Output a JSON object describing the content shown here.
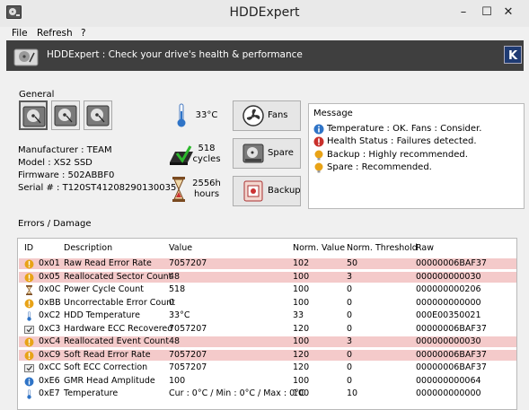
{
  "window": {
    "title": "HDDExpert"
  },
  "menu": [
    "File",
    "Refresh",
    "?"
  ],
  "banner": {
    "text": "HDDExpert : Check your drive's health & performance"
  },
  "general": {
    "label": "General",
    "drives": [
      "drive-1",
      "drive-2",
      "drive-3"
    ],
    "info": {
      "manufacturer": "Manufacturer : TEAM",
      "model": "Model : XS2 SSD",
      "firmware": "Firmware : 502ABBF0",
      "serial": "Serial # : T120ST41208290130035"
    },
    "temperature": "33°C",
    "cycles_value": "518",
    "cycles_unit": "cycles",
    "hours_value": "2556h",
    "hours_unit": "hours"
  },
  "buttons": {
    "fans": "Fans",
    "spare": "Spare",
    "backup": "Backup"
  },
  "message": {
    "title": "Message",
    "items": [
      {
        "icon": "info-icon",
        "text": "Temperature : OK. Fans : Consider."
      },
      {
        "icon": "error-icon",
        "text": "Health Status : Failures detected."
      },
      {
        "icon": "warning-icon",
        "text": "Backup : Highly recommended."
      },
      {
        "icon": "warning-icon",
        "text": "Spare : Recommended."
      }
    ]
  },
  "errors": {
    "label": "Errors / Damage",
    "columns": [
      "ID",
      "Description",
      "Value",
      "Norm. Value",
      "Norm. Threshold",
      "Raw"
    ],
    "rows": [
      {
        "icon": "warning-icon",
        "id": "0x01",
        "desc": "Raw Read Error Rate",
        "value": "7057207",
        "norm": "102",
        "thresh": "50",
        "raw": "00000006BAF37",
        "highlight": true
      },
      {
        "icon": "warning-icon",
        "id": "0x05",
        "desc": "Reallocated Sector Count",
        "value": "48",
        "norm": "100",
        "thresh": "3",
        "raw": "000000000030",
        "highlight": true
      },
      {
        "icon": "hourglass-icon",
        "id": "0x0C",
        "desc": "Power Cycle Count",
        "value": "518",
        "norm": "100",
        "thresh": "0",
        "raw": "000000000206",
        "highlight": false
      },
      {
        "icon": "warning-icon",
        "id": "0xBB",
        "desc": "Uncorrectable Error Count",
        "value": "0",
        "norm": "100",
        "thresh": "0",
        "raw": "000000000000",
        "highlight": false
      },
      {
        "icon": "thermometer-icon",
        "id": "0xC2",
        "desc": "HDD Temperature",
        "value": "33°C",
        "norm": "33",
        "thresh": "0",
        "raw": "000E00350021",
        "highlight": false
      },
      {
        "icon": "ecc-icon",
        "id": "0xC3",
        "desc": "Hardware ECC Recovered",
        "value": "7057207",
        "norm": "120",
        "thresh": "0",
        "raw": "00000006BAF37",
        "highlight": false
      },
      {
        "icon": "warning-icon",
        "id": "0xC4",
        "desc": "Reallocated Event Count",
        "value": "48",
        "norm": "100",
        "thresh": "3",
        "raw": "000000000030",
        "highlight": true
      },
      {
        "icon": "warning-icon",
        "id": "0xC9",
        "desc": "Soft Read Error Rate",
        "value": "7057207",
        "norm": "120",
        "thresh": "0",
        "raw": "00000006BAF37",
        "highlight": true
      },
      {
        "icon": "ecc-icon",
        "id": "0xCC",
        "desc": "Soft ECC Correction",
        "value": "7057207",
        "norm": "120",
        "thresh": "0",
        "raw": "00000006BAF37",
        "highlight": false
      },
      {
        "icon": "info-icon",
        "id": "0xE6",
        "desc": "GMR Head Amplitude",
        "value": "100",
        "norm": "100",
        "thresh": "0",
        "raw": "000000000064",
        "highlight": false
      },
      {
        "icon": "thermometer-icon",
        "id": "0xE7",
        "desc": "Temperature",
        "value": "Cur : 0°C / Min : 0°C / Max : 0°C",
        "norm": "100",
        "thresh": "10",
        "raw": "000000000000",
        "highlight": false
      }
    ]
  },
  "colors": {
    "highlight_row": "#f4caca",
    "banner": "#3f3f3f",
    "info": "#2f74c7",
    "error": "#c9302c",
    "warning": "#e8a317"
  }
}
